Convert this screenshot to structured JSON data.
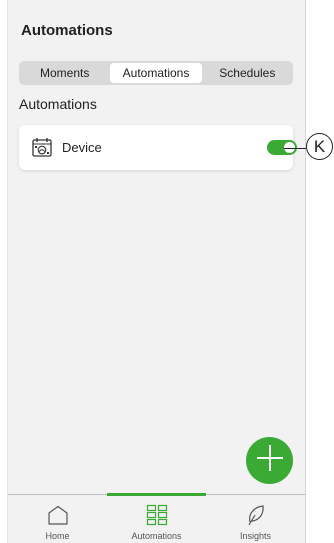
{
  "header": {
    "title": "Automations"
  },
  "segmented": {
    "tabs": [
      {
        "label": "Moments"
      },
      {
        "label": "Automations"
      },
      {
        "label": "Schedules"
      }
    ],
    "active_index": 1
  },
  "section": {
    "title": "Automations"
  },
  "automation_item": {
    "label": "Device",
    "enabled": true,
    "icon": "device-schedule-icon"
  },
  "callout": {
    "letter": "K"
  },
  "fab": {
    "icon": "plus-icon"
  },
  "tabbar": {
    "items": [
      {
        "label": "Home",
        "icon": "home-icon"
      },
      {
        "label": "Automations",
        "icon": "grid-icon"
      },
      {
        "label": "Insights",
        "icon": "leaf-icon"
      }
    ],
    "active_index": 1
  },
  "colors": {
    "accent": "#3aaa35",
    "background": "#f2f2f2",
    "card": "#ffffff"
  }
}
